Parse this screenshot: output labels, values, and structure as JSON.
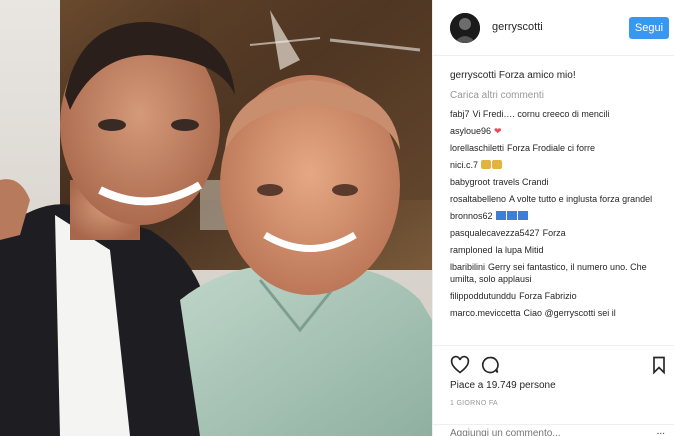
{
  "post": {
    "username": "gerryscotti",
    "follow_label": "Segui",
    "caption_user": "gerryscotti",
    "caption_text": "Forza amico mio!",
    "load_more": "Carica altri commenti",
    "comments": [
      {
        "user": "fabj7",
        "text": "Vi Fredi…. cornu creeco di mencili",
        "extra": ""
      },
      {
        "user": "asyloue96",
        "text": "",
        "extra": "heart"
      },
      {
        "user": "lorellaschiletti",
        "text": "Forza Frodiale ci forre",
        "extra": ""
      },
      {
        "user": "nici.c.7",
        "text": "",
        "extra": "emoji2"
      },
      {
        "user": "babygroot",
        "text": "travels Crandi",
        "extra": ""
      },
      {
        "user": "rosaltabelleno",
        "text": "A volte tutto e inglusta forza grandel",
        "extra": ""
      },
      {
        "user": "bronnos62",
        "text": "",
        "extra": "blue3"
      },
      {
        "user": "pasqualecavezza5427",
        "text": "Forza",
        "extra": ""
      },
      {
        "user": "ramploned",
        "text": "la lupa Mitid",
        "extra": ""
      },
      {
        "user": "lbaribilini",
        "text": "Gerry sei fantastico, il numero uno. Che umilta, solo applausi",
        "extra": ""
      },
      {
        "user": "filippoddutunddu",
        "text": "Forza Fabrizio",
        "extra": ""
      },
      {
        "user": "marco.meviccetta",
        "text": "Ciao @gerryscotti sei il",
        "extra": ""
      }
    ],
    "likes": "Piace a 19.749 persone",
    "time": "1 GIORNO FA",
    "add_comment_placeholder": "Aggiungi un commento...",
    "more_label": "...",
    "icons": {
      "like": "heart-icon",
      "comment": "comment-bubble-icon",
      "save": "bookmark-icon"
    },
    "colors": {
      "follow_button": "#3897f0",
      "muted_text": "#999999",
      "heart": "#ed4956"
    }
  }
}
